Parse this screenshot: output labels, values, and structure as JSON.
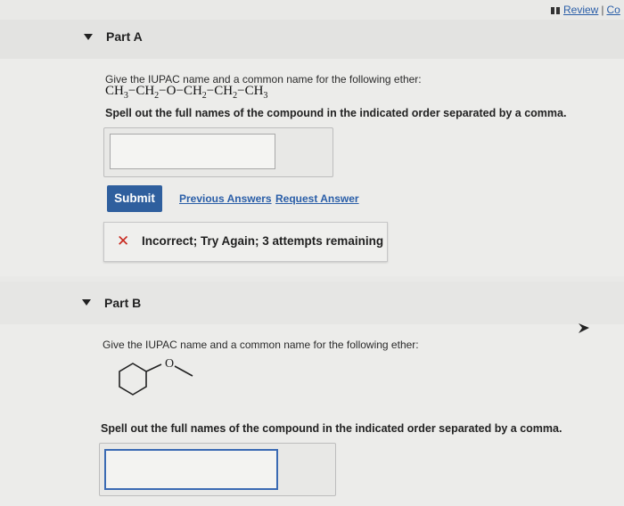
{
  "header": {
    "review_label": "Review",
    "separator": "|",
    "constants_label": "Co"
  },
  "part_a": {
    "title": "Part A",
    "question": "Give the IUPAC name and a common name for the following ether:",
    "formula": {
      "g1": "CH",
      "s1": "3",
      "b1": "−",
      "g2": "CH",
      "s2": "2",
      "b2": "−",
      "g3": "O",
      "b3": "−",
      "g4": "CH",
      "s4": "2",
      "b4": "−",
      "g5": "CH",
      "s5": "2",
      "b5": "−",
      "g6": "CH",
      "s6": "3"
    },
    "instruction": "Spell out the full names of the compound in the indicated order separated by a comma.",
    "answer_value": "",
    "submit_label": "Submit",
    "previous_answers_label": "Previous Answers",
    "request_answer_label": "Request Answer",
    "feedback_icon": "x-icon",
    "feedback_text": "Incorrect; Try Again; 3 attempts remaining"
  },
  "part_b": {
    "title": "Part B",
    "question": "Give the IUPAC name and a common name for the following ether:",
    "structure_atom": "O",
    "instruction": "Spell out the full names of the compound in the indicated order separated by a comma.",
    "answer_value": ""
  },
  "icons": {
    "part_a_toggle": "triangle-down-icon",
    "part_b_toggle": "triangle-down-icon",
    "review_icon": "bars-icon",
    "cursor": "cursor-arrow-icon"
  },
  "colors": {
    "accent": "#2f5f9e",
    "link": "#2a5ea8",
    "error": "#c8281e",
    "focus_border": "#3a6ab3"
  }
}
